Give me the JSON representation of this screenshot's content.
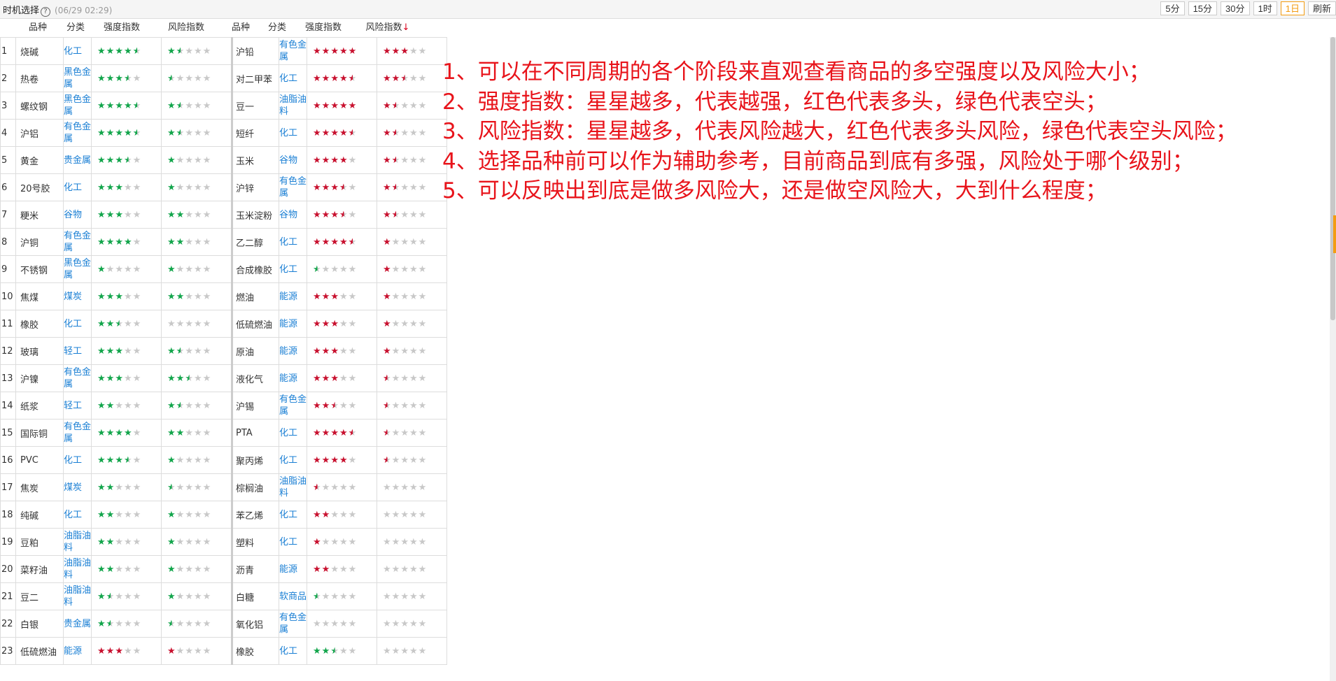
{
  "title": "时机选择",
  "timestamp": "(06/29 02:29)",
  "periods": [
    "5分",
    "15分",
    "30分",
    "1时",
    "1日",
    "刷新"
  ],
  "active_period": "1日",
  "headers": [
    "品种",
    "分类",
    "强度指数",
    "风险指数",
    "品种",
    "分类",
    "强度指数",
    "风险指数"
  ],
  "sort_arrow": "↓",
  "colors": {
    "bull": "#c8102e",
    "bear": "#12a54b",
    "link": "#1a7fd4",
    "note": "#e8141b"
  },
  "rows": [
    {
      "i": "1",
      "n1": "烧碱",
      "c1": "化工",
      "s1": [
        "g",
        4.5
      ],
      "r1": [
        "g",
        1.5
      ],
      "n2": "沪铅",
      "c2": "有色金属",
      "s2": [
        "r",
        5
      ],
      "r2": [
        "r",
        3
      ]
    },
    {
      "i": "2",
      "n1": "热卷",
      "c1": "黑色金属",
      "s1": [
        "g",
        3.5
      ],
      "r1": [
        "g",
        0.5
      ],
      "n2": "对二甲苯",
      "c2": "化工",
      "s2": [
        "r",
        4.5
      ],
      "r2": [
        "r",
        2.5
      ]
    },
    {
      "i": "3",
      "n1": "螺纹钢",
      "c1": "黑色金属",
      "s1": [
        "g",
        4.5
      ],
      "r1": [
        "g",
        1.5
      ],
      "n2": "豆一",
      "c2": "油脂油料",
      "s2": [
        "r",
        5
      ],
      "r2": [
        "r",
        1.5
      ]
    },
    {
      "i": "4",
      "n1": "沪铝",
      "c1": "有色金属",
      "s1": [
        "g",
        4.5
      ],
      "r1": [
        "g",
        1.5
      ],
      "n2": "短纤",
      "c2": "化工",
      "s2": [
        "r",
        4.5
      ],
      "r2": [
        "r",
        1.5
      ]
    },
    {
      "i": "5",
      "n1": "黄金",
      "c1": "贵金属",
      "s1": [
        "g",
        3.5
      ],
      "r1": [
        "g",
        1
      ],
      "n2": "玉米",
      "c2": "谷物",
      "s2": [
        "r",
        4
      ],
      "r2": [
        "r",
        1.5
      ]
    },
    {
      "i": "6",
      "n1": "20号胶",
      "c1": "化工",
      "s1": [
        "g",
        3
      ],
      "r1": [
        "g",
        1
      ],
      "n2": "沪锌",
      "c2": "有色金属",
      "s2": [
        "r",
        3.5
      ],
      "r2": [
        "r",
        1.5
      ]
    },
    {
      "i": "7",
      "n1": "粳米",
      "c1": "谷物",
      "s1": [
        "g",
        3
      ],
      "r1": [
        "g",
        2
      ],
      "n2": "玉米淀粉",
      "c2": "谷物",
      "s2": [
        "r",
        3.5
      ],
      "r2": [
        "r",
        1.5
      ]
    },
    {
      "i": "8",
      "n1": "沪铜",
      "c1": "有色金属",
      "s1": [
        "g",
        4
      ],
      "r1": [
        "g",
        2
      ],
      "n2": "乙二醇",
      "c2": "化工",
      "s2": [
        "r",
        4.5
      ],
      "r2": [
        "r",
        1
      ]
    },
    {
      "i": "9",
      "n1": "不锈钢",
      "c1": "黑色金属",
      "s1": [
        "g",
        1
      ],
      "r1": [
        "g",
        1
      ],
      "n2": "合成橡胶",
      "c2": "化工",
      "s2": [
        "g",
        0.5
      ],
      "r2": [
        "r",
        1
      ]
    },
    {
      "i": "10",
      "n1": "焦煤",
      "c1": "煤炭",
      "s1": [
        "g",
        3
      ],
      "r1": [
        "g",
        2
      ],
      "n2": "燃油",
      "c2": "能源",
      "s2": [
        "r",
        3
      ],
      "r2": [
        "r",
        1
      ]
    },
    {
      "i": "11",
      "n1": "橡胶",
      "c1": "化工",
      "s1": [
        "g",
        2.5
      ],
      "r1": [
        "g",
        0
      ],
      "n2": "低硫燃油",
      "c2": "能源",
      "s2": [
        "r",
        3
      ],
      "r2": [
        "r",
        1
      ]
    },
    {
      "i": "12",
      "n1": "玻璃",
      "c1": "轻工",
      "s1": [
        "g",
        3
      ],
      "r1": [
        "g",
        1.5
      ],
      "n2": "原油",
      "c2": "能源",
      "s2": [
        "r",
        3
      ],
      "r2": [
        "r",
        1
      ]
    },
    {
      "i": "13",
      "n1": "沪镍",
      "c1": "有色金属",
      "s1": [
        "g",
        3
      ],
      "r1": [
        "g",
        2.5
      ],
      "n2": "液化气",
      "c2": "能源",
      "s2": [
        "r",
        3
      ],
      "r2": [
        "r",
        0.5
      ]
    },
    {
      "i": "14",
      "n1": "纸浆",
      "c1": "轻工",
      "s1": [
        "g",
        2
      ],
      "r1": [
        "g",
        1.5
      ],
      "n2": "沪锡",
      "c2": "有色金属",
      "s2": [
        "r",
        2.5
      ],
      "r2": [
        "r",
        0.5
      ]
    },
    {
      "i": "15",
      "n1": "国际铜",
      "c1": "有色金属",
      "s1": [
        "g",
        4
      ],
      "r1": [
        "g",
        2
      ],
      "n2": "PTA",
      "c2": "化工",
      "s2": [
        "r",
        4.5
      ],
      "r2": [
        "r",
        0.5
      ]
    },
    {
      "i": "16",
      "n1": "PVC",
      "c1": "化工",
      "s1": [
        "g",
        3.5
      ],
      "r1": [
        "g",
        1
      ],
      "n2": "聚丙烯",
      "c2": "化工",
      "s2": [
        "r",
        4
      ],
      "r2": [
        "r",
        0.5
      ]
    },
    {
      "i": "17",
      "n1": "焦炭",
      "c1": "煤炭",
      "s1": [
        "g",
        2
      ],
      "r1": [
        "g",
        0.5
      ],
      "n2": "棕榈油",
      "c2": "油脂油料",
      "s2": [
        "r",
        0.5
      ],
      "r2": [
        "r",
        0
      ]
    },
    {
      "i": "18",
      "n1": "纯碱",
      "c1": "化工",
      "s1": [
        "g",
        2
      ],
      "r1": [
        "g",
        1
      ],
      "n2": "苯乙烯",
      "c2": "化工",
      "s2": [
        "r",
        2
      ],
      "r2": [
        "r",
        0
      ]
    },
    {
      "i": "19",
      "n1": "豆粕",
      "c1": "油脂油料",
      "s1": [
        "g",
        2
      ],
      "r1": [
        "g",
        1
      ],
      "n2": "塑料",
      "c2": "化工",
      "s2": [
        "r",
        1
      ],
      "r2": [
        "r",
        0
      ]
    },
    {
      "i": "20",
      "n1": "菜籽油",
      "c1": "油脂油料",
      "s1": [
        "g",
        2
      ],
      "r1": [
        "g",
        1
      ],
      "n2": "沥青",
      "c2": "能源",
      "s2": [
        "r",
        2
      ],
      "r2": [
        "r",
        0
      ]
    },
    {
      "i": "21",
      "n1": "豆二",
      "c1": "油脂油料",
      "s1": [
        "g",
        1.5
      ],
      "r1": [
        "g",
        1
      ],
      "n2": "白糖",
      "c2": "软商品",
      "s2": [
        "g",
        0.5
      ],
      "r2": [
        "r",
        0
      ]
    },
    {
      "i": "22",
      "n1": "白银",
      "c1": "贵金属",
      "s1": [
        "g",
        1.5
      ],
      "r1": [
        "g",
        0.5
      ],
      "n2": "氧化铝",
      "c2": "有色金属",
      "s2": [
        "r",
        0
      ],
      "r2": [
        "r",
        0
      ]
    },
    {
      "i": "23",
      "n1": "低硫燃油",
      "c1": "能源",
      "s1": [
        "r",
        3
      ],
      "r1": [
        "r",
        1
      ],
      "n2": "橡胶",
      "c2": "化工",
      "s2": [
        "g",
        2.5
      ],
      "r2": [
        "r",
        0
      ]
    }
  ],
  "notes": [
    "1、可以在不同周期的各个阶段来直观查看商品的多空强度以及风险大小；",
    "2、强度指数：星星越多，代表越强，红色代表多头，绿色代表空头；",
    "3、风险指数：星星越多，代表风险越大，红色代表多头风险，绿色代表空头风险；",
    "4、选择品种前可以作为辅助参考，目前商品到底有多强，风险处于哪个级别；",
    "5、可以反映出到底是做多风险大，还是做空风险大，大到什么程度；"
  ]
}
